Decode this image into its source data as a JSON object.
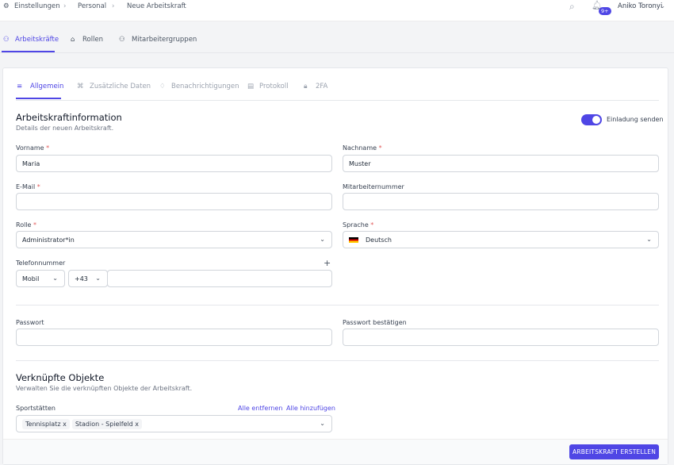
{
  "breadcrumb": [
    "Einstellungen",
    "Personal",
    "Neue Arbeitskraft"
  ],
  "header": {
    "user": "Aniko Toronyi",
    "notifications_badge": "9+"
  },
  "subnav": [
    "Arbeitskräfte",
    "Rollen",
    "Mitarbeitergruppen"
  ],
  "tabs": [
    "Allgemein",
    "Zusätzliche Daten",
    "Benachrichtigungen",
    "Protokoll",
    "2FA"
  ],
  "section1": {
    "title": "Arbeitskraftinformation",
    "subtitle": "Details der neuen Arbeitskraft.",
    "invite_label": "Einladung senden",
    "invite_on": true
  },
  "fields": {
    "vorname": {
      "label": "Vorname",
      "value": "Maria"
    },
    "nachname": {
      "label": "Nachname",
      "value": "Muster"
    },
    "email": {
      "label": "E-Mail",
      "value": ""
    },
    "mitarbeiternummer": {
      "label": "Mitarbeiternummer",
      "value": ""
    },
    "rolle": {
      "label": "Rolle",
      "value": "Administrator*in"
    },
    "sprache": {
      "label": "Sprache",
      "value": "Deutsch"
    },
    "telefon": {
      "label": "Telefonnummer",
      "type": "Mobil",
      "prefix": "+43",
      "add": "+",
      "value": ""
    },
    "passwort": {
      "label": "Passwort",
      "value": ""
    },
    "passwort2": {
      "label": "Passwort bestätigen",
      "value": ""
    }
  },
  "section2": {
    "title": "Verknüpfte Objekte",
    "subtitle": "Verwalten Sie die verknüpften Objekte der Arbeitskraft.",
    "field_label": "Sportstätten",
    "remove_all": "Alle entfernen",
    "add_all": "Alle hinzufügen",
    "chips": [
      "Tennisplatz",
      "Stadion - Spielfeld"
    ],
    "chip_remove": "x"
  },
  "submit_label": "ARBEITSKRAFT ERSTELLEN",
  "colors": {
    "accent": "#4f46e5"
  }
}
